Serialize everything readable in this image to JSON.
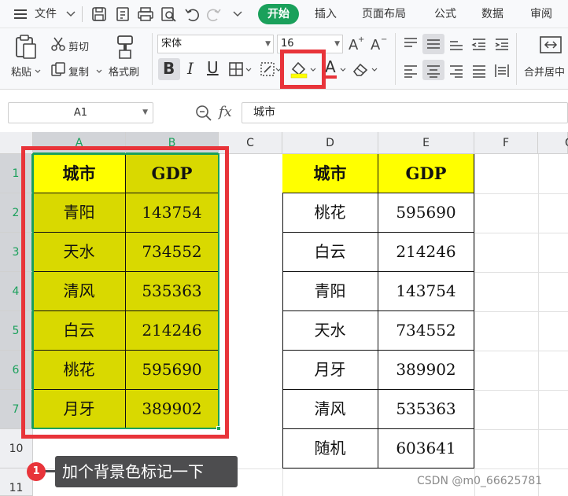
{
  "menubar": {
    "file_label": "文件",
    "tabs": [
      {
        "label": "开始",
        "active": true
      },
      {
        "label": "插入"
      },
      {
        "label": "页面布局"
      },
      {
        "label": "公式"
      },
      {
        "label": "数据"
      },
      {
        "label": "审阅"
      }
    ]
  },
  "ribbon": {
    "paste_label": "粘贴",
    "cut_label": "剪切",
    "copy_label": "复制",
    "format_painter_label": "格式刷",
    "font_name": "宋体",
    "font_size": "16",
    "bold": "B",
    "italic": "I",
    "underline": "U",
    "font_color_glyph": "A",
    "merge_label": "合并居中"
  },
  "colors": {
    "accent": "#1aa05b",
    "highlight_red": "#e8343a",
    "fill_olive": "#d9d900",
    "fill_yellow": "#ffff00",
    "callout_bg": "#4d4d4f"
  },
  "formula_bar": {
    "name_box": "A1",
    "fx_label": "fx",
    "content": "城市"
  },
  "grid": {
    "columns": [
      "A",
      "B",
      "C",
      "D",
      "E",
      "F",
      "G"
    ],
    "rows": [
      "1",
      "2",
      "3",
      "4",
      "5",
      "6",
      "7",
      "10",
      "11"
    ],
    "table1": {
      "headers": [
        "城市",
        "GDP"
      ],
      "rows": [
        [
          "青阳",
          "143754"
        ],
        [
          "天水",
          "734552"
        ],
        [
          "清风",
          "535363"
        ],
        [
          "白云",
          "214246"
        ],
        [
          "桃花",
          "595690"
        ],
        [
          "月牙",
          "389902"
        ]
      ]
    },
    "table2": {
      "headers": [
        "城市",
        "GDP"
      ],
      "rows": [
        [
          "桃花",
          "595690"
        ],
        [
          "白云",
          "214246"
        ],
        [
          "青阳",
          "143754"
        ],
        [
          "天水",
          "734552"
        ],
        [
          "月牙",
          "389902"
        ],
        [
          "清风",
          "535363"
        ],
        [
          "随机",
          "603641"
        ]
      ]
    }
  },
  "callout": {
    "step": "1",
    "text": "加个背景色标记一下"
  },
  "watermark": "CSDN @m0_66625781"
}
